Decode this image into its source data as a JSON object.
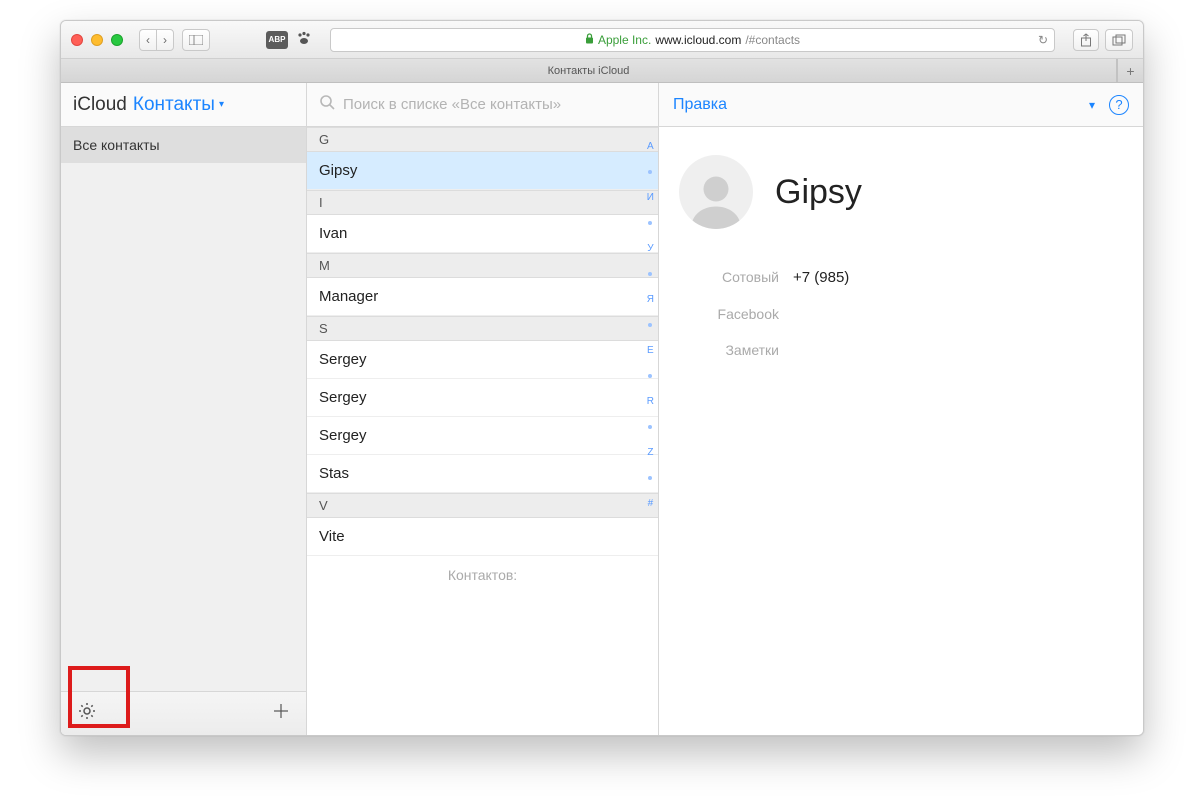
{
  "browser": {
    "abp": "ABP",
    "address_company": "Apple Inc.",
    "address_domain": "www.icloud.com",
    "address_path": "/#contacts",
    "tab_title": "Контакты iCloud"
  },
  "sidebar": {
    "app_label": "iCloud",
    "menu_label": "Контакты",
    "groups": [
      {
        "label": "Все контакты"
      }
    ]
  },
  "search": {
    "placeholder": "Поиск в списке «Все контакты»"
  },
  "contacts": {
    "sections": [
      {
        "letter": "G",
        "items": [
          {
            "name": "Gipsy",
            "selected": true
          }
        ]
      },
      {
        "letter": "I",
        "items": [
          {
            "name": "Ivan"
          }
        ]
      },
      {
        "letter": "M",
        "items": [
          {
            "name": "Manager"
          }
        ]
      },
      {
        "letter": "S",
        "items": [
          {
            "name": "Sergey"
          },
          {
            "name": "Sergey"
          },
          {
            "name": "Sergey"
          },
          {
            "name": "Stas"
          }
        ]
      },
      {
        "letter": "V",
        "items": [
          {
            "name": "Vite"
          }
        ]
      }
    ],
    "count_label": "Контактов:",
    "index": [
      "А",
      "И",
      "У",
      "Я",
      "E",
      "R",
      "Z",
      "#"
    ]
  },
  "detail": {
    "edit_label": "Правка",
    "name": "Gipsy",
    "fields": [
      {
        "label": "Сотовый",
        "value": "+7 (985)"
      },
      {
        "label": "Facebook",
        "value": ""
      },
      {
        "label": "Заметки",
        "value": ""
      }
    ]
  }
}
